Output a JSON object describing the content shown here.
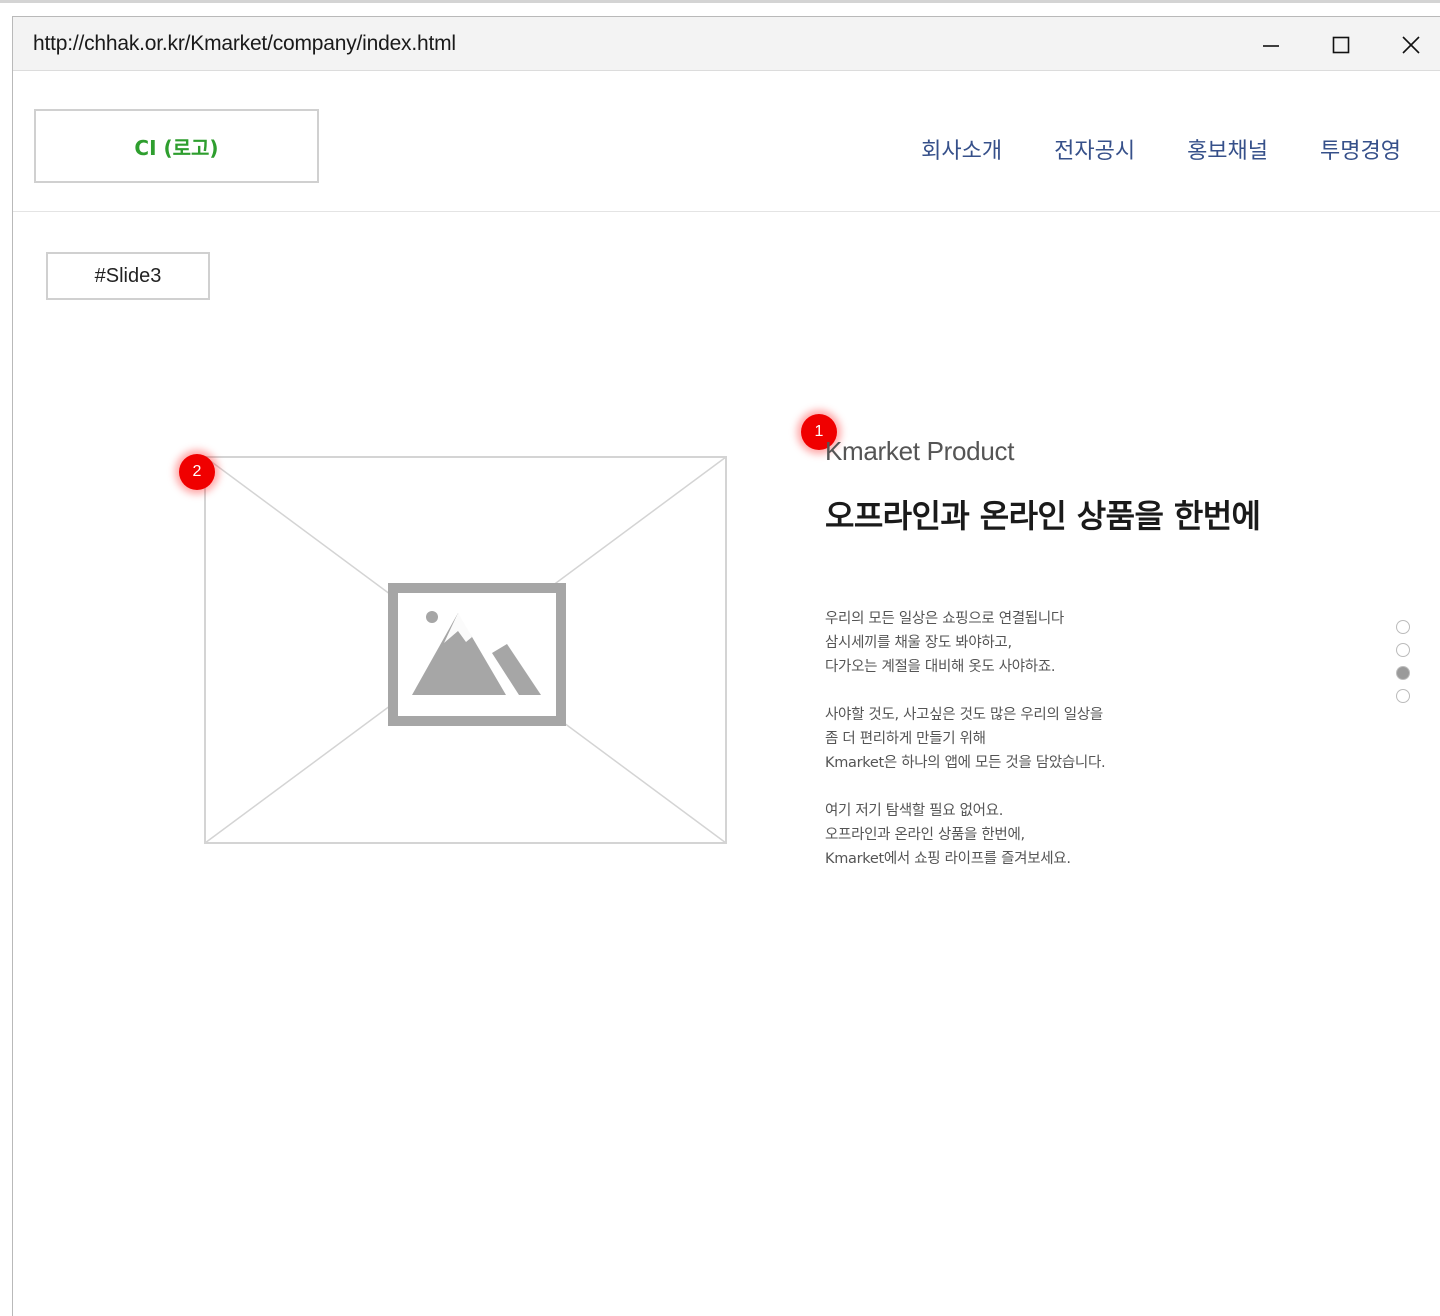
{
  "window": {
    "url": "http://chhak.or.kr/Kmarket/company/index.html",
    "controls": [
      "minimize-icon",
      "maximize-icon",
      "close-icon"
    ]
  },
  "header": {
    "logo": "CI (로고)",
    "nav": [
      {
        "label": "회사소개"
      },
      {
        "label": "전자공시"
      },
      {
        "label": "홍보채널"
      },
      {
        "label": "투명경영"
      }
    ]
  },
  "slide": {
    "label": "#Slide3",
    "markers": [
      "1",
      "2"
    ],
    "image_icon": "image-placeholder-icon",
    "eyebrow": "Kmarket Product",
    "headline": "오프라인과 온라인 상품을 한번에",
    "paragraphs": [
      [
        "우리의 모든 일상은 쇼핑으로 연결됩니다",
        "삼시세끼를 채울 장도 봐야하고,",
        "다가오는 계절을 대비해 옷도 사야하죠."
      ],
      [
        "사야할 것도, 사고싶은 것도 많은 우리의 일상을",
        "좀 더 편리하게 만들기 위해",
        "Kmarket은 하나의 앱에 모든 것을 담았습니다."
      ],
      [
        "여기 저기 탐색할 필요 없어요.",
        "오프라인과 온라인 상품을 한번에,",
        "Kmarket에서 쇼핑 라이프를 즐겨보세요."
      ]
    ],
    "pagination": {
      "count": 4,
      "active_index": 2
    }
  },
  "colors": {
    "nav": "#36508a",
    "logo": "#2e9e2e",
    "marker": "#f00000",
    "placeholder": "#a6a6a6"
  }
}
